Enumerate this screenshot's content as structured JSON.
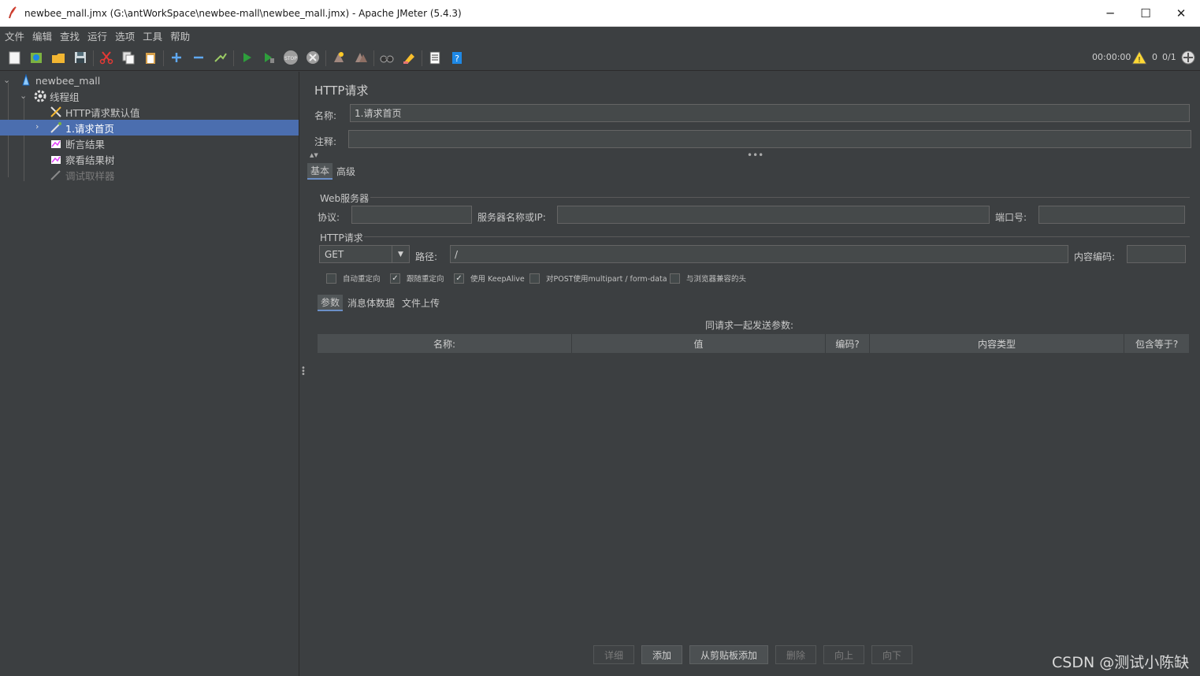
{
  "window": {
    "title": "newbee_mall.jmx (G:\\antWorkSpace\\newbee-mall\\newbee_mall.jmx) - Apache JMeter (5.4.3)",
    "minimize": "─",
    "maximize": "☐",
    "close": "✕"
  },
  "menu": [
    "文件",
    "编辑",
    "查找",
    "运行",
    "选项",
    "工具",
    "帮助"
  ],
  "toolbar": {
    "timer": "00:00:00",
    "warning_count": "0",
    "threads": "0/1"
  },
  "tree": {
    "root": "newbee_mall",
    "thread_group": "线程组",
    "http_defaults": "HTTP请求默认值",
    "sampler": "1.请求首页",
    "assertion_results": "断言结果",
    "view_results_tree": "察看结果树",
    "debug_sampler": "调试取样器"
  },
  "panel": {
    "title": "HTTP请求",
    "name_label": "名称:",
    "name_value": "1.请求首页",
    "comment_label": "注释:",
    "comment_value": "",
    "tabs": [
      "基本",
      "高级"
    ],
    "web_server_group": "Web服务器",
    "protocol_label": "协议:",
    "protocol_value": "",
    "server_label": "服务器名称或IP:",
    "server_value": "",
    "port_label": "端口号:",
    "port_value": "",
    "http_group": "HTTP请求",
    "method": "GET",
    "path_label": "路径:",
    "path_value": "/",
    "encoding_label": "内容编码:",
    "encoding_value": "",
    "checkboxes": [
      {
        "label": "自动重定向",
        "checked": false
      },
      {
        "label": "跟随重定向",
        "checked": true
      },
      {
        "label": "使用 KeepAlive",
        "checked": true
      },
      {
        "label": "对POST使用multipart / form-data",
        "checked": false
      },
      {
        "label": "与浏览器兼容的头",
        "checked": false
      }
    ],
    "sub_tabs": [
      "参数",
      "消息体数据",
      "文件上传"
    ],
    "params_caption": "同请求一起发送参数:",
    "columns": [
      "名称:",
      "值",
      "编码?",
      "内容类型",
      "包含等于?"
    ],
    "buttons": [
      "详细",
      "添加",
      "从剪贴板添加",
      "删除",
      "向上",
      "向下"
    ]
  },
  "watermark": "CSDN @测试小陈缺"
}
